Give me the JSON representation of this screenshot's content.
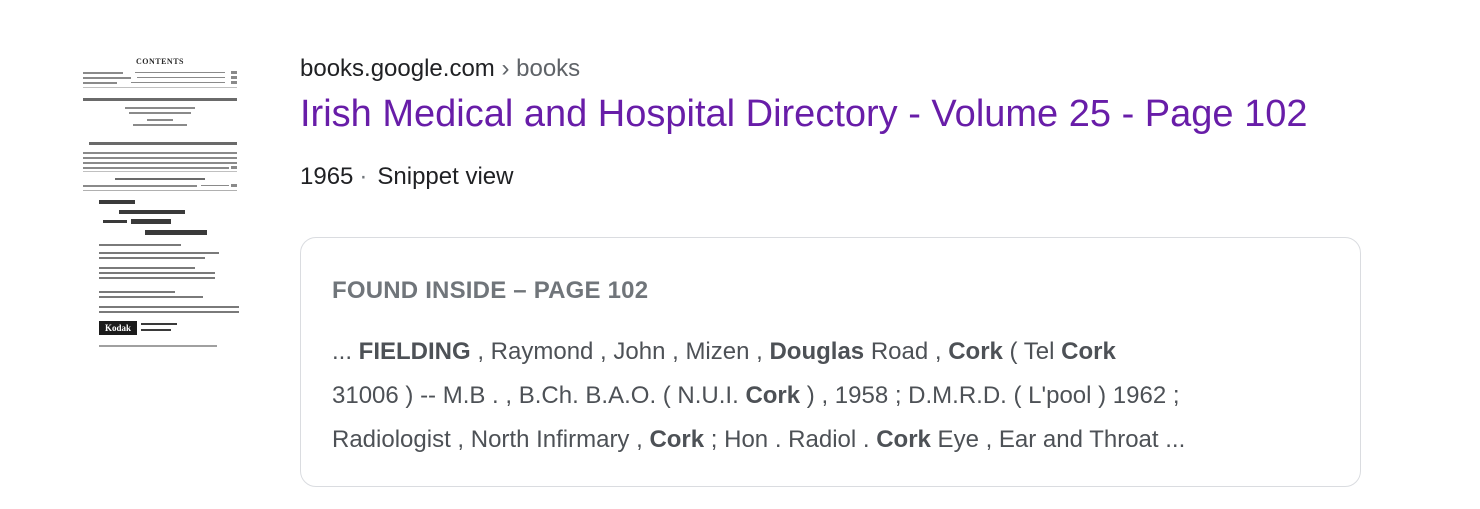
{
  "result": {
    "thumbnail": {
      "alt": "Book cover thumbnail",
      "title_text": "CONTENTS",
      "brand_text": "Kodak"
    },
    "cite": {
      "domain": "books.google.com",
      "separator": "›",
      "path": "books"
    },
    "title": "Irish Medical and Hospital Directory - Volume 25 - Page 102",
    "meta": {
      "year": "1965",
      "separator": "·",
      "view": "Snippet view"
    },
    "snippet_box": {
      "heading": "FOUND INSIDE – PAGE 102",
      "lines": [
        [
          {
            "text": "... ",
            "bold": false
          },
          {
            "text": "FIELDING",
            "bold": true
          },
          {
            "text": " , Raymond , John , Mizen , ",
            "bold": false
          },
          {
            "text": "Douglas",
            "bold": true
          },
          {
            "text": " Road , ",
            "bold": false
          },
          {
            "text": "Cork",
            "bold": true
          },
          {
            "text": " ( Tel ",
            "bold": false
          },
          {
            "text": "Cork",
            "bold": true
          }
        ],
        [
          {
            "text": "31006 ) -- M.B . , B.Ch. B.A.O. ( N.U.I. ",
            "bold": false
          },
          {
            "text": "Cork",
            "bold": true
          },
          {
            "text": " ) , 1958 ; D.M.R.D. ( L'pool ) 1962 ;",
            "bold": false
          }
        ],
        [
          {
            "text": "Radiologist , North Infirmary , ",
            "bold": false
          },
          {
            "text": "Cork",
            "bold": true
          },
          {
            "text": " ; Hon . Radiol . ",
            "bold": false
          },
          {
            "text": "Cork",
            "bold": true
          },
          {
            "text": " Eye , Ear and Throat ...",
            "bold": false
          }
        ]
      ]
    }
  }
}
